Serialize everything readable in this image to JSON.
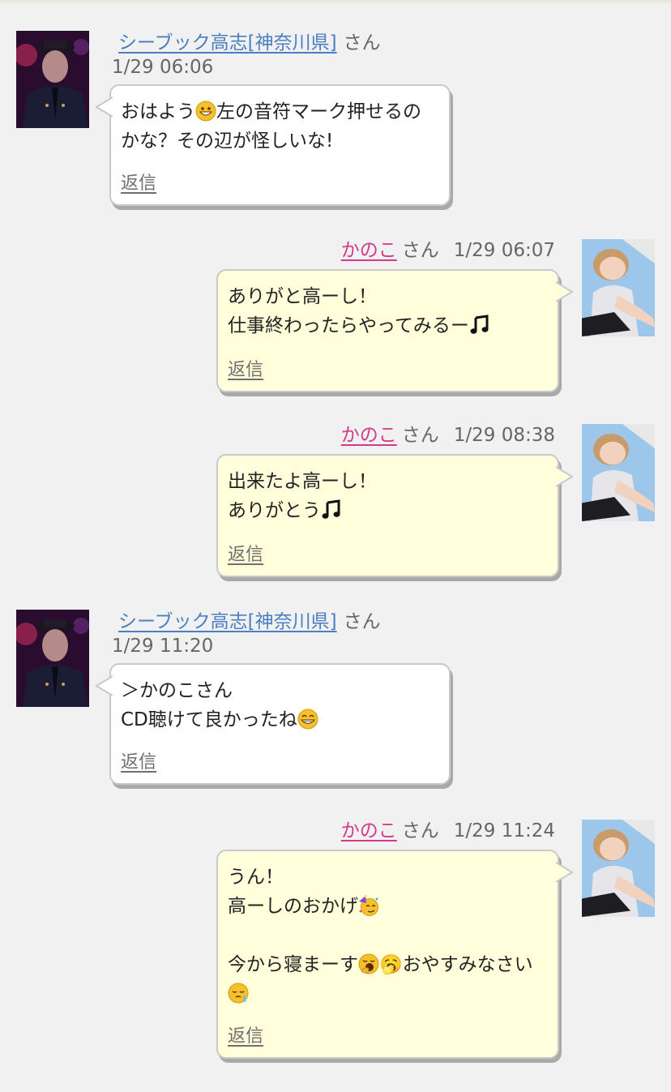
{
  "messages": [
    {
      "side": "left",
      "sender": "シーブック高志[神奈川県]",
      "honorific": "さん",
      "time": "1/29 06:06",
      "lines": [
        "おはよう",
        "😀",
        "左の音符マーク押せるの",
        "\n",
        "かな？その辺が怪しいな!"
      ],
      "reply": "返信"
    },
    {
      "side": "right",
      "sender": "かのこ",
      "honorific": "さん",
      "time": "1/29 06:07",
      "lines": [
        "ありがと高ーし！",
        "\n",
        "仕事終わったらやってみるー",
        "🎵"
      ],
      "reply": "返信"
    },
    {
      "side": "right",
      "sender": "かのこ",
      "honorific": "さん",
      "time": "1/29 08:38",
      "lines": [
        "出来たよ高ーし！",
        "\n",
        "ありがとう",
        "🎵"
      ],
      "reply": "返信"
    },
    {
      "side": "left",
      "sender": "シーブック高志[神奈川県]",
      "honorific": "さん",
      "time": "1/29 11:20",
      "lines": [
        "＞かのこさん",
        "\n",
        "CD聴けて良かったね",
        "😁"
      ],
      "reply": "返信"
    },
    {
      "side": "right",
      "sender": "かのこ",
      "honorific": "さん",
      "time": "1/29 11:24",
      "lines": [
        "うん！",
        "\n",
        "高ーしのおかげ",
        "🥳",
        "\n",
        "\n",
        "今から寝まーす",
        "🥱",
        "\n",
        "おやすみなさい",
        "😪"
      ],
      "reply": "返信"
    }
  ],
  "icons": {
    "left_avatar": "uniformed-man-avatar",
    "right_avatar": "woman-selfie-avatar"
  }
}
